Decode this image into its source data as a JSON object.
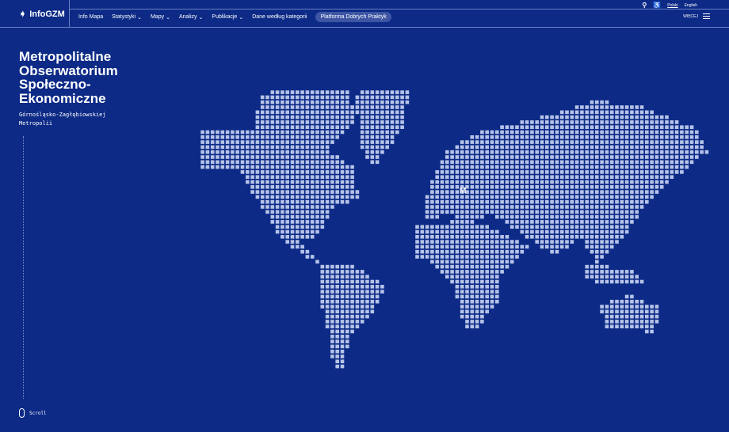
{
  "header": {
    "logo": "InfoGZM",
    "nav": [
      {
        "label": "Info Mapa",
        "dropdown": false
      },
      {
        "label": "Statystyki",
        "dropdown": true
      },
      {
        "label": "Mapy",
        "dropdown": true
      },
      {
        "label": "Analizy",
        "dropdown": true
      },
      {
        "label": "Publikacje",
        "dropdown": true
      },
      {
        "label": "Dane według kategorii",
        "dropdown": false
      }
    ],
    "highlight": "Platforma Dobrych Praktyk",
    "lang_pl": "Polski",
    "lang_en": "English",
    "more": "WIĘCEJ"
  },
  "hero": {
    "title": "Metropolitalne Obserwatorium Społeczno-Ekonomiczne",
    "subtitle_1": "Górnośląsko-Zagłębiowskiej",
    "subtitle_2": "Metropolii",
    "scroll": "Scroll"
  },
  "colors": {
    "background": "#0c2a86",
    "dot": "#b7c4e8"
  }
}
